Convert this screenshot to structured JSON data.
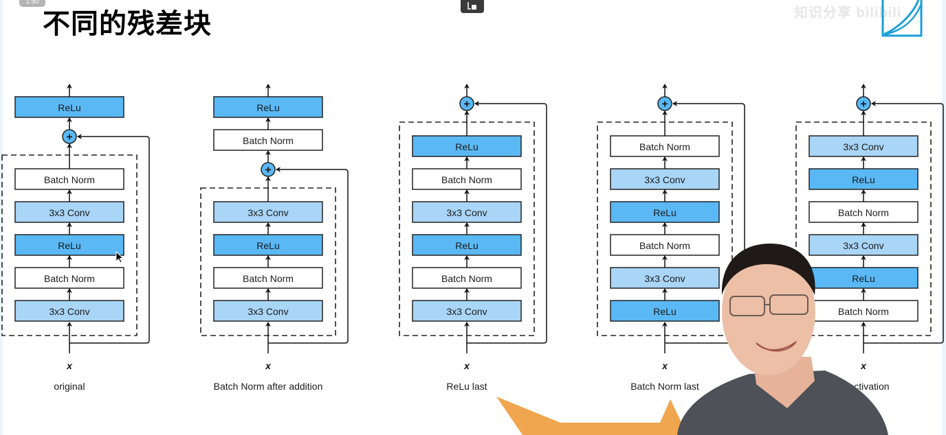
{
  "slide": {
    "title": "不同的残差块",
    "time_badge": "1:50",
    "watermark": "知识分享 bilibili"
  },
  "colors": {
    "relu": "#5ab8f5",
    "conv": "#a9d5f7",
    "batch_norm": "#ffffff",
    "add_node": "#5ab8f5",
    "arrow_shape": "#f0a64e"
  },
  "legend_labels": {
    "relu": "ReLu",
    "conv": "3x3 Conv",
    "batch_norm": "Batch Norm",
    "add": "+",
    "input": "x"
  },
  "blocks": [
    {
      "caption": "original",
      "layers_bottom_to_top": [
        "3x3 Conv",
        "Batch Norm",
        "ReLu",
        "3x3 Conv",
        "Batch Norm"
      ],
      "layer_types": [
        "conv",
        "batch_norm",
        "relu",
        "conv",
        "batch_norm"
      ],
      "after_addition": [
        "ReLu"
      ],
      "after_types": [
        "relu"
      ]
    },
    {
      "caption": "Batch Norm after addition",
      "layers_bottom_to_top": [
        "3x3 Conv",
        "Batch Norm",
        "ReLu",
        "3x3 Conv"
      ],
      "layer_types": [
        "conv",
        "batch_norm",
        "relu",
        "conv"
      ],
      "after_addition": [
        "Batch Norm",
        "ReLu"
      ],
      "after_types": [
        "batch_norm",
        "relu"
      ]
    },
    {
      "caption": "ReLu last",
      "layers_bottom_to_top": [
        "3x3 Conv",
        "Batch Norm",
        "ReLu",
        "3x3 Conv",
        "Batch Norm",
        "ReLu"
      ],
      "layer_types": [
        "conv",
        "batch_norm",
        "relu",
        "conv",
        "batch_norm",
        "relu"
      ],
      "after_addition": [],
      "after_types": []
    },
    {
      "caption": "Batch Norm last",
      "layers_bottom_to_top": [
        "ReLu",
        "3x3 Conv",
        "Batch Norm",
        "ReLu",
        "3x3 Conv",
        "Batch Norm"
      ],
      "layer_types": [
        "relu",
        "conv",
        "batch_norm",
        "relu",
        "conv",
        "batch_norm"
      ],
      "after_addition": [],
      "after_types": []
    },
    {
      "caption": "activation",
      "layers_bottom_to_top": [
        "Batch Norm",
        "ReLu",
        "3x3 Conv",
        "Batch Norm",
        "ReLu",
        "3x3 Conv"
      ],
      "layer_types": [
        "batch_norm",
        "relu",
        "conv",
        "batch_norm",
        "relu",
        "conv"
      ],
      "after_addition": [],
      "after_types": []
    }
  ]
}
